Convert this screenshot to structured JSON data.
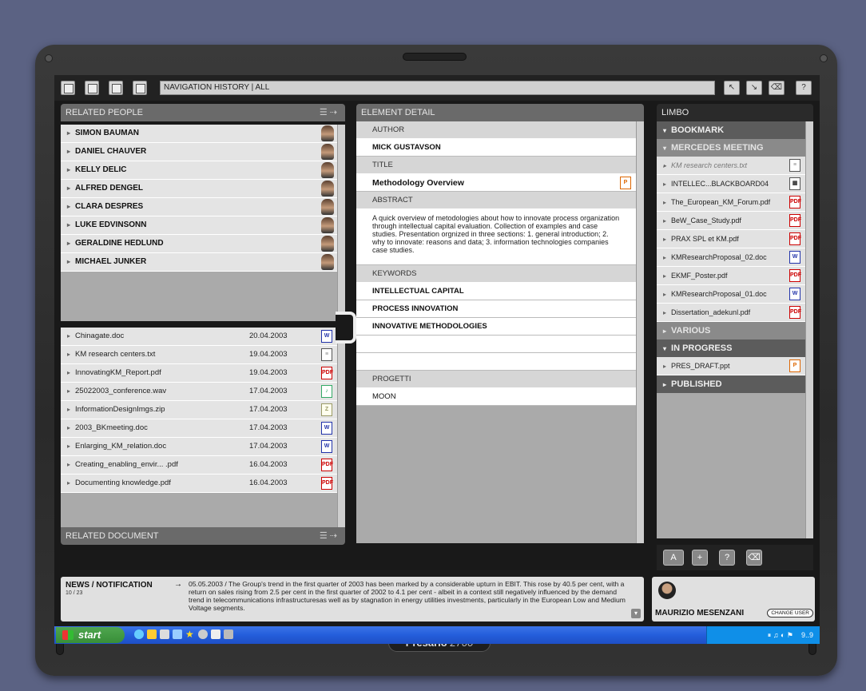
{
  "toolbar": {
    "nav_history": "NAVIGATION HISTORY | ALL",
    "nav_buttons": [
      "↖",
      "↘",
      "⌫",
      "?"
    ]
  },
  "related_people": {
    "title": "RELATED PEOPLE",
    "people": [
      "SIMON BAUMAN",
      "DANIEL CHAUVER",
      "KELLY DELIC",
      "ALFRED DENGEL",
      "CLARA DESPRES",
      "LUKE EDVINSONN",
      "GERALDINE HEDLUND",
      "MICHAEL JUNKER"
    ]
  },
  "related_documents": {
    "title": "RELATED DOCUMENT",
    "docs": [
      {
        "name": "Chinagate.doc",
        "date": "20.04.2003",
        "type": "doc"
      },
      {
        "name": "KM research centers.txt",
        "date": "19.04.2003",
        "type": "txt"
      },
      {
        "name": "InnovatingKM_Report.pdf",
        "date": "19.04.2003",
        "type": "pdf"
      },
      {
        "name": "25022003_conference.wav",
        "date": "17.04.2003",
        "type": "wav"
      },
      {
        "name": "InformationDesignImgs.zip",
        "date": "17.04.2003",
        "type": "zip"
      },
      {
        "name": "2003_BKmeeting.doc",
        "date": "17.04.2003",
        "type": "doc"
      },
      {
        "name": "Enlarging_KM_relation.doc",
        "date": "17.04.2003",
        "type": "doc"
      },
      {
        "name": "Creating_enabling_envir... .pdf",
        "date": "16.04.2003",
        "type": "pdf"
      },
      {
        "name": "Documenting knowledge.pdf",
        "date": "16.04.2003",
        "type": "pdf"
      }
    ]
  },
  "element_detail": {
    "title": "ELEMENT DETAIL",
    "author_label": "AUTHOR",
    "author": "MICK GUSTAVSON",
    "title_label": "TITLE",
    "doc_title": "Methodology Overview",
    "abstract_label": "ABSTRACT",
    "abstract": "A quick overview of metodologies about how to innovate process organization through intellectual capital evaluation. Collection of examples and case studies. Presentation orgnized in three sections: 1. general introduction; 2. why to innovate: reasons and data; 3. information technologies companies case studies.",
    "keywords_label": "KEYWORDS",
    "keywords": [
      "INTELLECTUAL CAPITAL",
      "PROCESS INNOVATION",
      "INNOVATIVE METHODOLOGIES"
    ],
    "progetti_label": "PROGETTI",
    "progetti": "MOON"
  },
  "limbo": {
    "title": "LIMBO",
    "bookmark": "BOOKMARK",
    "mercedes": "MERCEDES MEETING",
    "mercedes_items": [
      {
        "name": "KM research centers.txt",
        "type": "txt"
      },
      {
        "name": "INTELLEC...BLACKBOARD04",
        "type": "bb"
      },
      {
        "name": "The_European_KM_Forum.pdf",
        "type": "pdf"
      },
      {
        "name": "BeW_Case_Study.pdf",
        "type": "pdf"
      },
      {
        "name": "PRAX SPL et KM.pdf",
        "type": "pdf"
      },
      {
        "name": "KMResearchProposal_02.doc",
        "type": "doc"
      },
      {
        "name": "EKMF_Poster.pdf",
        "type": "pdf"
      },
      {
        "name": "KMResearchProposal_01.doc",
        "type": "doc"
      },
      {
        "name": "Dissertation_adekunl.pdf",
        "type": "pdf"
      }
    ],
    "various": "VARIOUS",
    "in_progress": "IN PROGRESS",
    "in_progress_items": [
      {
        "name": "PRES_DRAFT.ppt",
        "type": "ppt"
      }
    ],
    "published": "PUBLISHED"
  },
  "news": {
    "title": "NEWS / NOTIFICATION",
    "count": "10 / 23",
    "text": "05.05.2003 / The Group's trend in the first quarter of 2003 has been marked by a considerable upturn in EBIT. This rose by 40.5 per cent, with a return on sales rising from 2.5 per cent in the first quarter of 2002 to 4.1 per cent - albeit in a context still negatively influenced by the demand trend in telecommunications infrastructuresas well as by stagnation in energy utilities investments, particularly in the European Low and Medium Voltage segments."
  },
  "user": {
    "name": "MAURIZIO MESENZANI",
    "change": "CHANGE USER"
  },
  "taskbar": {
    "start": "start",
    "clock": "9..9"
  },
  "device": {
    "brand": "Presario",
    "model": "2700"
  }
}
